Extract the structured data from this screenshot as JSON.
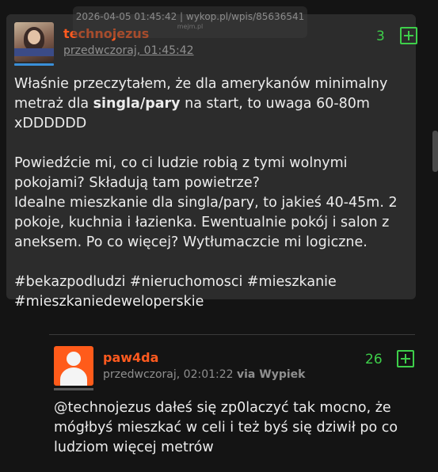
{
  "watermark": {
    "text": "2026-04-05 01:45:42 | wykop.pl/wpis/85636541",
    "logo": "mejm.pl"
  },
  "post": {
    "author": "technojezus",
    "timestamp": "przedwczoraj, 01:45:42",
    "score": "3",
    "paragraph1_before": "Właśnie przeczytałem, że dla amerykanów minimalny metraż dla ",
    "paragraph1_bold": "singla/pary",
    "paragraph1_after": " na start, to uwaga 60-80m xDDDDDD",
    "line2": "Powiedźcie mi, co ci ludzie robią z tymi wolnymi pokojami? Składują tam powietrze?",
    "line3": "Idealne mieszkanie dla singla/pary, to jakieś 40-45m. 2 pokoje, kuchnia i łazienka. Ewentualnie pokój i salon z aneksem. Po co więcej? Wytłumaczcie mi logiczne.",
    "tags": "#bekazpodludzi #nieruchomosci #mieszkanie #mieszkaniedeweloperskie"
  },
  "reply": {
    "author": "paw4da",
    "timestamp": "przedwczoraj, 02:01:22",
    "via": "via Wypiek",
    "score": "26",
    "mention": "@technojezus",
    "text": " dałeś się zp0laczyć tak mocno, że mógłbyś mieszkać w celi i też byś się dziwił po co ludziom więcej metrów"
  },
  "colors": {
    "author": "#ff5a1f",
    "score": "#3ecf4a",
    "background": "#141414",
    "card": "#2c2c2c"
  }
}
